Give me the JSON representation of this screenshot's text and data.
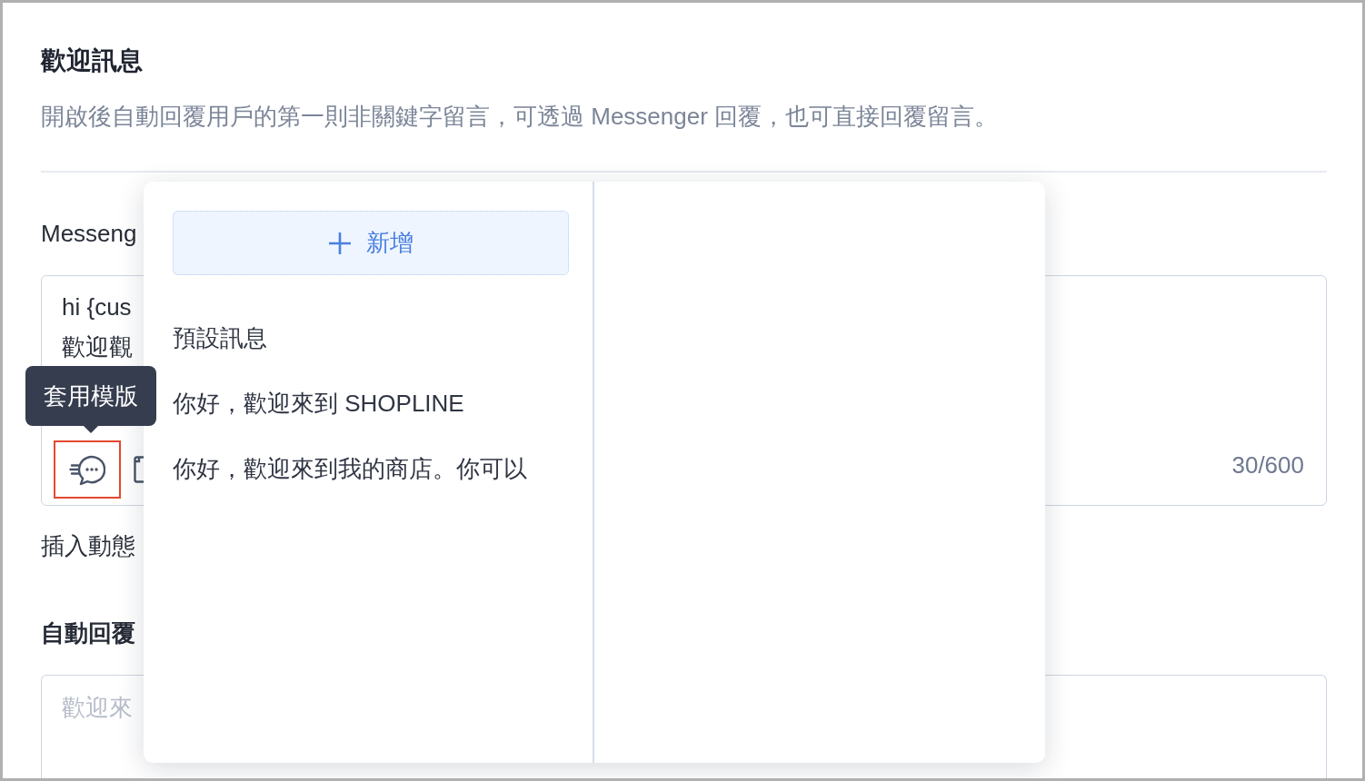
{
  "section": {
    "title": "歡迎訊息",
    "description": "開啟後自動回覆用戶的第一則非關鍵字留言，可透過 Messenger 回覆，也可直接回覆留言。"
  },
  "messenger": {
    "label": "Messeng",
    "value": "hi {cus\n歡迎觀",
    "template_button": {
      "highlighted": true
    },
    "tooltip": "套用模版",
    "counter": "30/600",
    "insert_link": "插入動態"
  },
  "auto_reply": {
    "label": "自動回覆",
    "placeholder": "歡迎來"
  },
  "template_popover": {
    "add_button": "新增",
    "templates": [
      {
        "title": "預設訊息"
      },
      {
        "title": "你好，歡迎來到 SHOPLINE"
      },
      {
        "title": "你好，歡迎來到我的商店。你可以"
      }
    ]
  }
}
